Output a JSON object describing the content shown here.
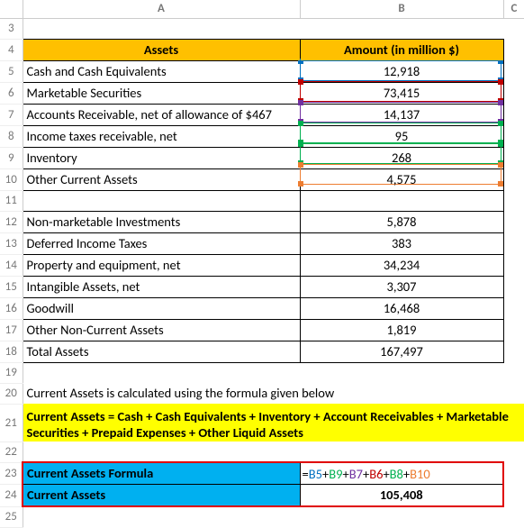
{
  "columns": {
    "A": "A",
    "B": "B",
    "C": "C"
  },
  "rowlabels": [
    "3",
    "4",
    "5",
    "6",
    "7",
    "8",
    "9",
    "10",
    "11",
    "12",
    "13",
    "14",
    "15",
    "16",
    "17",
    "18",
    "19",
    "20",
    "21",
    "22",
    "23",
    "24",
    "25"
  ],
  "header": {
    "A": "Assets",
    "B": "Amount (in million $)"
  },
  "assets_current": [
    {
      "label": "Cash and Cash Equivalents",
      "value": "12,918"
    },
    {
      "label": "Marketable Securities",
      "value": "73,415"
    },
    {
      "label": "Accounts Receivable, net of allowance of $467",
      "value": "14,137"
    },
    {
      "label": "Income taxes receivable, net",
      "value": "95"
    },
    {
      "label": "Inventory",
      "value": "268"
    },
    {
      "label": "Other Current Assets",
      "value": "4,575"
    }
  ],
  "assets_noncurrent": [
    {
      "label": "Non-marketable Investments",
      "value": "5,878"
    },
    {
      "label": "Deferred Income Taxes",
      "value": "383"
    },
    {
      "label": "Property and equipment, net",
      "value": "34,234"
    },
    {
      "label": "Intangible Assets, net",
      "value": "3,307"
    },
    {
      "label": "Goodwill",
      "value": "16,468"
    },
    {
      "label": "Other Non-Current Assets",
      "value": "1,819"
    },
    {
      "label": "Total Assets",
      "value": "167,497"
    }
  ],
  "note": "Current Assets is calculated using the formula given below",
  "formula_text": "Current Assets = Cash + Cash Equivalents + Inventory + Account Receivables + Marketable Securities + Prepaid Expenses + Other Liquid Assets",
  "result_rows": {
    "formula_label": "Current Assets Formula",
    "formula_parts": {
      "eq": "=",
      "b5": "B5",
      "b9": "B9",
      "b7": "B7",
      "b6": "B6",
      "b8": "B8",
      "b10": "B10",
      "plus": "+"
    },
    "value_label": "Current Assets",
    "value": "105,408"
  },
  "chart_data": {
    "type": "table",
    "title": "Assets and Amounts (in million $)",
    "columns": [
      "Assets",
      "Amount (in million $)"
    ],
    "rows": [
      [
        "Cash and Cash Equivalents",
        12918
      ],
      [
        "Marketable Securities",
        73415
      ],
      [
        "Accounts Receivable, net of allowance of $467",
        14137
      ],
      [
        "Income taxes receivable, net",
        95
      ],
      [
        "Inventory",
        268
      ],
      [
        "Other Current Assets",
        4575
      ],
      [
        "Non-marketable Investments",
        5878
      ],
      [
        "Deferred Income Taxes",
        383
      ],
      [
        "Property and equipment, net",
        34234
      ],
      [
        "Intangible Assets, net",
        3307
      ],
      [
        "Goodwill",
        16468
      ],
      [
        "Other Non-Current Assets",
        1819
      ],
      [
        "Total Assets",
        167497
      ],
      [
        "Current Assets",
        105408
      ]
    ],
    "derived": {
      "Current Assets formula": "=B5+B9+B7+B6+B8+B10",
      "Current Assets": 105408
    }
  }
}
